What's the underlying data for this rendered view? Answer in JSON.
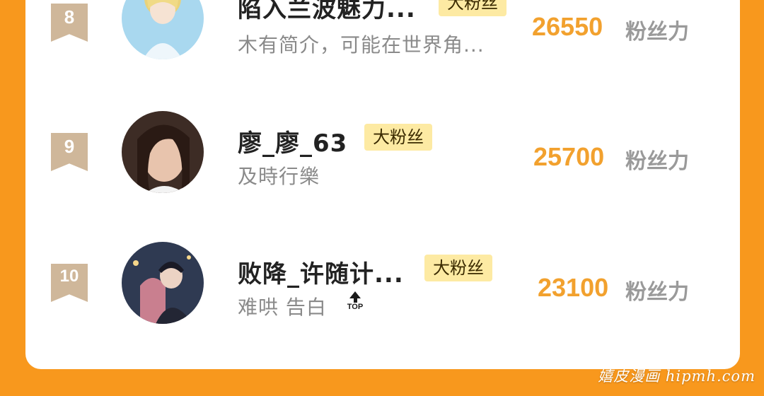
{
  "rows": [
    {
      "rank": "8",
      "name": "陷入兰波魅力...",
      "tag": "大粉丝",
      "bio": "木有简介，可能在世界角...",
      "score": "26550",
      "score_unit": "粉丝力"
    },
    {
      "rank": "9",
      "name": "廖_廖_63",
      "tag": "大粉丝",
      "bio": "及時行樂",
      "score": "25700",
      "score_unit": "粉丝力"
    },
    {
      "rank": "10",
      "name": "败降_许随计...",
      "tag": "大粉丝",
      "bio": "难哄 告白",
      "bio_icon": "top-icon",
      "bio_icon_text": "TOP",
      "score": "23100",
      "score_unit": "粉丝力"
    }
  ],
  "watermark": "嬉皮漫画 hipmh.com",
  "colors": {
    "background": "#f8981d",
    "card": "#ffffff",
    "rank_badge": "#cfb79a",
    "score": "#f2a12e",
    "tag_bg": "#fdeaa3"
  }
}
